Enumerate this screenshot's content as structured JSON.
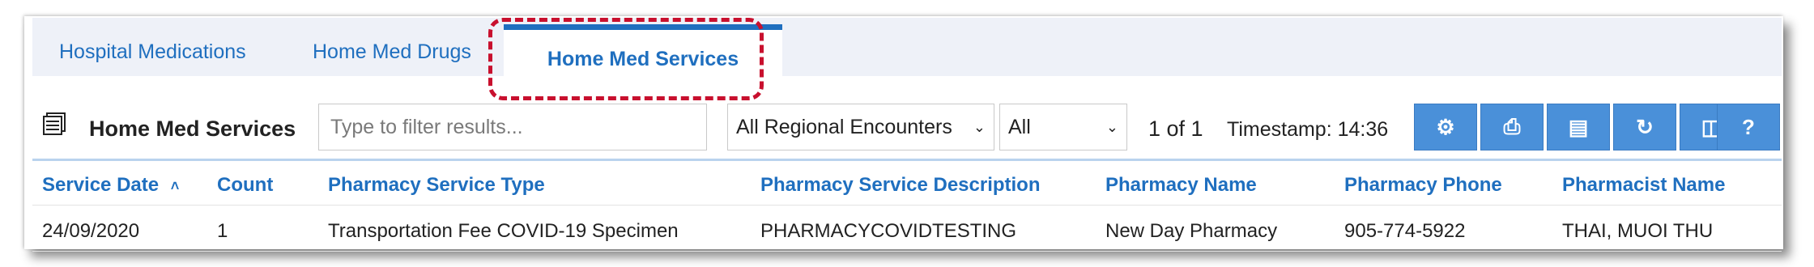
{
  "tabs": [
    {
      "label": "Hospital Medications",
      "active": false
    },
    {
      "label": "Home Med Drugs",
      "active": false
    },
    {
      "label": "Home Med Services",
      "active": true
    }
  ],
  "toolbar": {
    "title": "Home Med Services",
    "filter_placeholder": "Type to filter results...",
    "encounter_select": "All Regional Encounters",
    "scope_select": "All",
    "pager": "1 of 1",
    "timestamp": "Timestamp: 14:36",
    "buttons": [
      {
        "icon": "gear-icon",
        "glyph": "⚙"
      },
      {
        "icon": "print-icon",
        "glyph": "⎙"
      },
      {
        "icon": "list-icon",
        "glyph": "▤"
      },
      {
        "icon": "refresh-icon",
        "glyph": "↻"
      },
      {
        "icon": "columns-icon",
        "glyph": "◫"
      },
      {
        "icon": "help-icon",
        "glyph": "?"
      }
    ]
  },
  "table": {
    "columns": [
      "Service Date",
      "Count",
      "Pharmacy Service Type",
      "Pharmacy Service Description",
      "Pharmacy Name",
      "Pharmacy Phone",
      "Pharmacist Name"
    ],
    "sort_indicator": "˄",
    "rows": [
      [
        "24/09/2020",
        "1",
        "Transportation Fee COVID-19 Specimen",
        "PHARMACYCOVIDTESTING",
        "New Day Pharmacy",
        "905-774-5922",
        "THAI, MUOI THU"
      ]
    ]
  },
  "colors": {
    "accent": "#1f6fbf",
    "button": "#4a90d9",
    "highlight": "#c8102e"
  }
}
